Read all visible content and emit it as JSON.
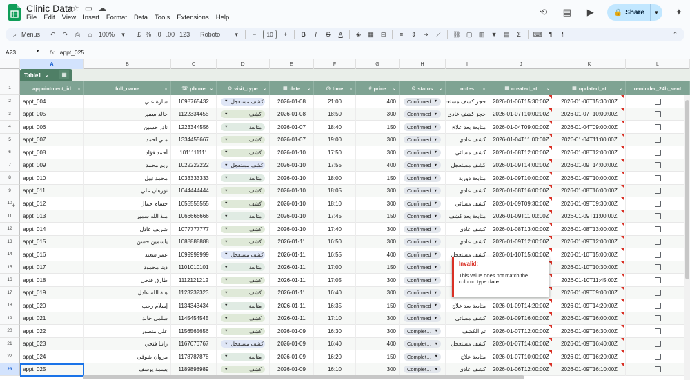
{
  "title": "Clinic Data",
  "menus": [
    "File",
    "Edit",
    "View",
    "Insert",
    "Format",
    "Data",
    "Tools",
    "Extensions",
    "Help"
  ],
  "share_label": "Share",
  "toolbar": {
    "search_label": "Menus",
    "zoom": "100%",
    "currency": "£",
    "percent": "%",
    "dec_decrease": ".0",
    "dec_increase": ".00",
    "number_format": "123",
    "font": "Roboto",
    "font_size": "10"
  },
  "formula": {
    "cell_ref": "A23",
    "fx": "fx",
    "value": "appt_025"
  },
  "columns": [
    "A",
    "B",
    "C",
    "D",
    "E",
    "F",
    "G",
    "H",
    "I",
    "J",
    "K",
    "L"
  ],
  "table_name": "Table1",
  "headers": [
    "appointment_id",
    "full_name",
    "phone",
    "visit_type",
    "date",
    "time",
    "price",
    "status",
    "notes",
    "created_at",
    "updated_at",
    "reminder_24h_sent"
  ],
  "row_numbers": [
    "1",
    "2",
    "3",
    "4",
    "5",
    "6",
    "7",
    "8",
    "9",
    "10",
    "11",
    "12",
    "13",
    "14",
    "15",
    "16",
    "17",
    "18",
    "19",
    "20",
    "21",
    "22",
    "23"
  ],
  "rows": [
    {
      "id": "appt_004",
      "name": "سارة علي",
      "phone": "1098765432",
      "visit": "كشف مستعجل",
      "date": "2026-01-08",
      "time": "21:00",
      "price": "400",
      "status": "Confirmed",
      "notes": "حجز كشف مستعجل",
      "created": "2026-01-06T15:30:00Z",
      "updated": "2026-01-06T15:30:00Z"
    },
    {
      "id": "appt_005",
      "name": "خالد سمير",
      "phone": "1122334455",
      "visit": "كشف",
      "date": "2026-01-08",
      "time": "18:50",
      "price": "300",
      "status": "Confirmed",
      "notes": "حجز كشف عادي",
      "created": "2026-01-07T10:00:00Z",
      "updated": "2026-01-07T10:00:00Z"
    },
    {
      "id": "appt_006",
      "name": "نادر حسين",
      "phone": "1223344556",
      "visit": "متابعة",
      "date": "2026-01-07",
      "time": "18:40",
      "price": "150",
      "status": "Confirmed",
      "notes": "متابعة بعد علاج",
      "created": "2026-01-04T09:00:00Z",
      "updated": "2026-01-04T09:00:00Z"
    },
    {
      "id": "appt_007",
      "name": "مني احمد",
      "phone": "1334455667",
      "visit": "كشف",
      "date": "2026-01-07",
      "time": "19:00",
      "price": "300",
      "status": "Confirmed",
      "notes": "كشف عادي",
      "created": "2026-01-04T11:00:00Z",
      "updated": "2026-01-04T11:00:00Z"
    },
    {
      "id": "appt_008",
      "name": "أحمد فؤاد",
      "phone": "1011111111",
      "visit": "كشف",
      "date": "2026-01-10",
      "time": "17:50",
      "price": "300",
      "status": "Confirmed",
      "notes": "كشف مسائي",
      "created": "2026-01-08T12:00:00Z",
      "updated": "2026-01-08T12:00:00Z"
    },
    {
      "id": "appt_009",
      "name": "ريم محمد",
      "phone": "1022222222",
      "visit": "كشف مستعجل",
      "date": "2026-01-10",
      "time": "17:55",
      "price": "400",
      "status": "Confirmed",
      "notes": "كشف مستعجل",
      "created": "2026-01-09T14:00:00Z",
      "updated": "2026-01-09T14:00:00Z"
    },
    {
      "id": "appt_010",
      "name": "محمد نبيل",
      "phone": "1033333333",
      "visit": "متابعة",
      "date": "2026-01-10",
      "time": "18:00",
      "price": "150",
      "status": "Confirmed",
      "notes": "متابعة دورية",
      "created": "2026-01-09T10:00:00Z",
      "updated": "2026-01-09T10:00:00Z"
    },
    {
      "id": "appt_011",
      "name": "نورهان علي",
      "phone": "1044444444",
      "visit": "كشف",
      "date": "2026-01-10",
      "time": "18:05",
      "price": "300",
      "status": "Confirmed",
      "notes": "كشف عادي",
      "created": "2026-01-08T16:00:00Z",
      "updated": "2026-01-08T16:00:00Z"
    },
    {
      "id": "appt_012",
      "name": "حسام جمال",
      "phone": "1055555555",
      "visit": "كشف",
      "date": "2026-01-10",
      "time": "18:10",
      "price": "300",
      "status": "Confirmed",
      "notes": "كشف مسائي",
      "created": "2026-01-09T09:30:00Z",
      "updated": "2026-01-09T09:30:00Z"
    },
    {
      "id": "appt_013",
      "name": "منة الله سمير",
      "phone": "1066666666",
      "visit": "متابعة",
      "date": "2026-01-10",
      "time": "17:45",
      "price": "150",
      "status": "Confirmed",
      "notes": "متابعة بعد كشف",
      "created": "2026-01-09T11:00:00Z",
      "updated": "2026-01-09T11:00:00Z"
    },
    {
      "id": "appt_014",
      "name": "شريف عادل",
      "phone": "1077777777",
      "visit": "كشف",
      "date": "2026-01-10",
      "time": "17:40",
      "price": "300",
      "status": "Confirmed",
      "notes": "كشف عادي",
      "created": "2026-01-08T13:00:00Z",
      "updated": "2026-01-08T13:00:00Z"
    },
    {
      "id": "appt_015",
      "name": "ياسمين حسن",
      "phone": "1088888888",
      "visit": "كشف",
      "date": "2026-01-11",
      "time": "16:50",
      "price": "300",
      "status": "Confirmed",
      "notes": "كشف عادي",
      "created": "2026-01-09T12:00:00Z",
      "updated": "2026-01-09T12:00:00Z"
    },
    {
      "id": "appt_016",
      "name": "عمر سعيد",
      "phone": "1099999999",
      "visit": "كشف مستعجل",
      "date": "2026-01-11",
      "time": "16:55",
      "price": "400",
      "status": "Confirmed",
      "notes": "كشف مستعجل",
      "created": "2026-01-10T15:00:00Z",
      "updated": "2026-01-10T15:00:00Z"
    },
    {
      "id": "appt_017",
      "name": "دينا محمود",
      "phone": "1101010101",
      "visit": "متابعة",
      "date": "2026-01-11",
      "time": "17:00",
      "price": "150",
      "status": "Confirmed",
      "notes": "",
      "created": "",
      "updated": "2026-01-10T10:30:00Z"
    },
    {
      "id": "appt_018",
      "name": "طارق فتحي",
      "phone": "1112121212",
      "visit": "كشف",
      "date": "2026-01-11",
      "time": "17:05",
      "price": "300",
      "status": "Confirmed",
      "notes": "",
      "created": "",
      "updated": "2026-01-10T11:45:00Z"
    },
    {
      "id": "appt_019",
      "name": "هبة الله عادل",
      "phone": "1123232323",
      "visit": "كشف",
      "date": "2026-01-11",
      "time": "16:40",
      "price": "300",
      "status": "Confirmed",
      "notes": "",
      "created": "",
      "updated": "2026-01-09T09:00:00Z"
    },
    {
      "id": "appt_020",
      "name": "إسلام رجب",
      "phone": "1134343434",
      "visit": "متابعة",
      "date": "2026-01-11",
      "time": "16:35",
      "price": "150",
      "status": "Confirmed",
      "notes": "متابعة بعد علاج",
      "created": "2026-01-09T14:20:00Z",
      "updated": "2026-01-09T14:20:00Z"
    },
    {
      "id": "appt_021",
      "name": "سلمي خالد",
      "phone": "1145454545",
      "visit": "كشف",
      "date": "2026-01-11",
      "time": "17:10",
      "price": "300",
      "status": "Confirmed",
      "notes": "كشف مسائي",
      "created": "2026-01-09T16:00:00Z",
      "updated": "2026-01-09T16:00:00Z"
    },
    {
      "id": "appt_022",
      "name": "علي منصور",
      "phone": "1156565656",
      "visit": "كشف",
      "date": "2026-01-09",
      "time": "16:30",
      "price": "300",
      "status": "Complet…",
      "notes": "تم الكشف",
      "created": "2026-01-07T12:00:00Z",
      "updated": "2026-01-09T16:30:00Z"
    },
    {
      "id": "appt_023",
      "name": "رانيا فتحي",
      "phone": "1167676767",
      "visit": "كشف مستعجل",
      "date": "2026-01-09",
      "time": "16:40",
      "price": "400",
      "status": "Complet…",
      "notes": "كشف مستعجل",
      "created": "2026-01-07T14:00:00Z",
      "updated": "2026-01-09T16:40:00Z"
    },
    {
      "id": "appt_024",
      "name": "مروان شوقي",
      "phone": "1178787878",
      "visit": "متابعة",
      "date": "2026-01-09",
      "time": "16:20",
      "price": "150",
      "status": "Complet…",
      "notes": "متابعة علاج",
      "created": "2026-01-07T10:00:00Z",
      "updated": "2026-01-09T16:20:00Z"
    },
    {
      "id": "appt_025",
      "name": "بسمة يوسف",
      "phone": "1189898989",
      "visit": "كشف",
      "date": "2026-01-09",
      "time": "16:10",
      "price": "300",
      "status": "Complet…",
      "notes": "كشف عادي",
      "created": "2026-01-06T12:00:00Z",
      "updated": "2026-01-09T16:10:00Z"
    }
  ],
  "tooltip": {
    "title": "Invalid:",
    "body_prefix": "This value does not match the column type",
    "body_type": "date"
  },
  "colors": {
    "table_header": "#7fa393",
    "error": "#d93025",
    "selection": "#1a73e8",
    "share_bg": "#c2e7ff"
  }
}
